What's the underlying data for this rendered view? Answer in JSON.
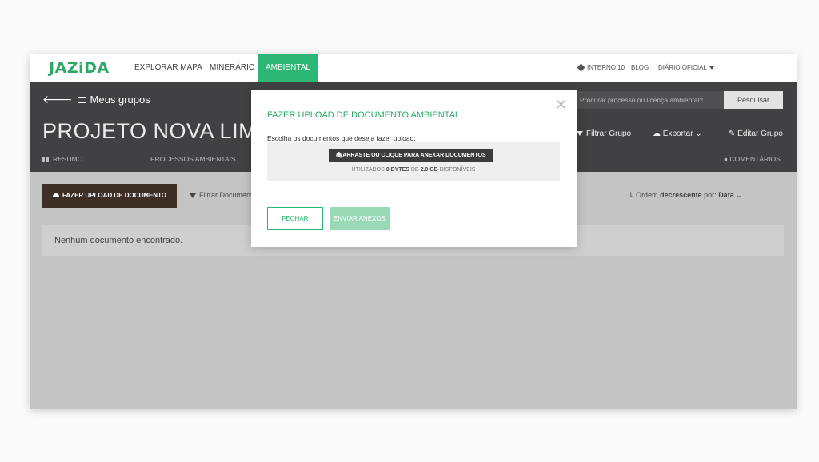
{
  "nav": {
    "logo": "JAZiDA",
    "links": [
      "EXPLORAR MAPA",
      "MINERÁRIO",
      "AMBIENTAL"
    ],
    "active": "AMBIENTAL",
    "right": {
      "interno": "INTERNO 10",
      "blog": "BLOG",
      "diario": "DIÁRIO OFICIAL"
    }
  },
  "header": {
    "back_label": "Meus grupos",
    "project_title": "PROJETO NOVA LIMA",
    "tabs": {
      "resumo": "RESUMO",
      "processos": "PROCESSOS AMBIENTAIS",
      "comentarios": "COMENTÁRIOS"
    },
    "search": {
      "placeholder": "Procurar processo ou licença ambiental?",
      "button": "Pesquisar"
    },
    "actions": {
      "filtrar": "Filtrar Grupo",
      "exportar": "Exportar",
      "editar": "Editar Grupo"
    }
  },
  "content": {
    "upload_button": "FAZER UPLOAD DE DOCUMENTO",
    "filter_docs": "Filtrar Document",
    "order": {
      "prefix": "Ordem",
      "direction": "decrescente",
      "by": "por:",
      "field": "Data"
    },
    "empty_message": "Nenhum documento encontrado."
  },
  "modal": {
    "title": "FAZER UPLOAD DE DOCUMENTO AMBIENTAL",
    "description": "Escolha os documentos que deseja fazer upload:",
    "drop_button": "ARRASTE OU CLIQUE PARA ANEXAR DOCUMENTOS",
    "usage": {
      "prefix": "UTILIZADOS",
      "used": "0 BYTES",
      "mid": "DE",
      "total": "2.0 GB",
      "suffix": "DISPONÍVEIS"
    },
    "close_button": "FECHAR",
    "send_button": "ENVIAR ANEXOS"
  },
  "colors": {
    "accent": "#2bb673",
    "header": "#414143",
    "upload_button": "#3d2f26"
  }
}
